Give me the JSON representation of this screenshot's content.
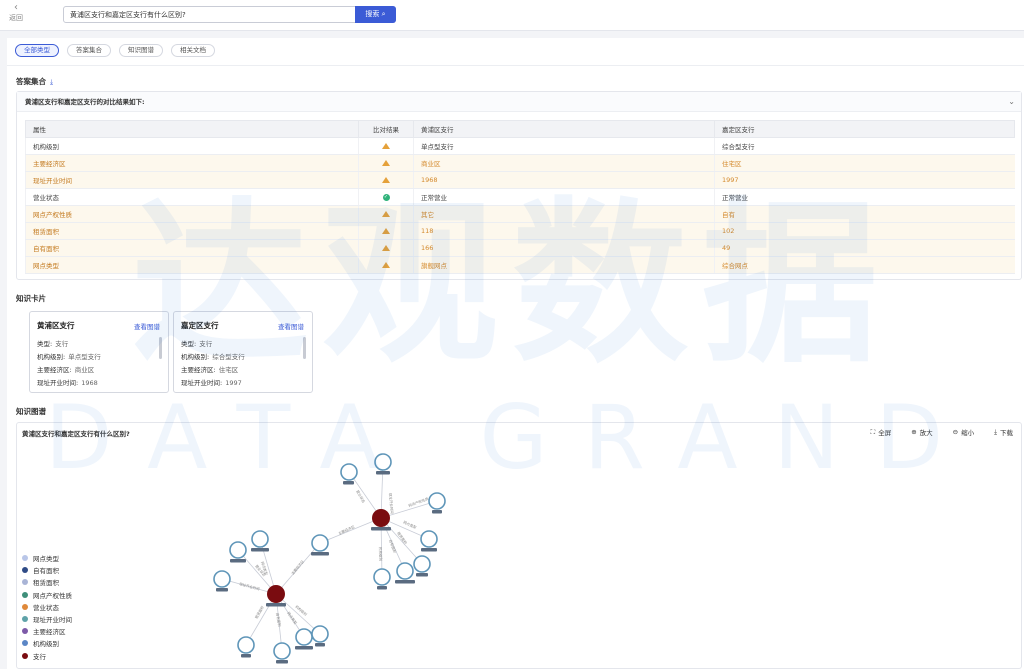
{
  "topbar": {
    "back_label": "返回",
    "search_value": "黄浦区支行和嘉定区支行有什么区别?",
    "search_button": "搜索"
  },
  "tabs": [
    {
      "label": "全部类型",
      "active": true
    },
    {
      "label": "答案集合",
      "active": false
    },
    {
      "label": "知识图谱",
      "active": false
    },
    {
      "label": "相关文档",
      "active": false
    }
  ],
  "answer": {
    "section_title": "答案集合",
    "summary": "黄浦区支行和嘉定区支行的对比结果如下:",
    "columns": [
      "属性",
      "比对结果",
      "黄浦区支行",
      "嘉定区支行"
    ],
    "rows": [
      {
        "attr": "机构级别",
        "result": "diff",
        "a": "单点型支行",
        "b": "综合型支行",
        "highlight": false
      },
      {
        "attr": "主要经济区",
        "result": "diff",
        "a": "商业区",
        "b": "住宅区",
        "highlight": true
      },
      {
        "attr": "现址开业时间",
        "result": "diff",
        "a": "1968",
        "b": "1997",
        "highlight": true
      },
      {
        "attr": "营业状态",
        "result": "same",
        "a": "正常营业",
        "b": "正常营业",
        "highlight": false
      },
      {
        "attr": "网点产权性质",
        "result": "diff",
        "a": "其它",
        "b": "自有",
        "highlight": true
      },
      {
        "attr": "租赁面积",
        "result": "diff",
        "a": "118",
        "b": "102",
        "highlight": true
      },
      {
        "attr": "自有面积",
        "result": "diff",
        "a": "166",
        "b": "49",
        "highlight": true
      },
      {
        "attr": "网点类型",
        "result": "diff",
        "a": "旗舰网点",
        "b": "综合网点",
        "highlight": true
      }
    ]
  },
  "cards": {
    "section_title": "知识卡片",
    "view_label": "查看图谱",
    "items": [
      {
        "title": "黄浦区支行",
        "fields": [
          {
            "k": "类型",
            "v": "支行"
          },
          {
            "k": "机构级别",
            "v": "单点型支行"
          },
          {
            "k": "主要经济区",
            "v": "商业区"
          },
          {
            "k": "现址开业时间",
            "v": "1968"
          }
        ]
      },
      {
        "title": "嘉定区支行",
        "fields": [
          {
            "k": "类型",
            "v": "支行"
          },
          {
            "k": "机构级别",
            "v": "综合型支行"
          },
          {
            "k": "主要经济区",
            "v": "住宅区"
          },
          {
            "k": "现址开业时间",
            "v": "1997"
          }
        ]
      }
    ]
  },
  "graph": {
    "section_title": "知识图谱",
    "query": "黄浦区支行和嘉定区支行有什么区别?",
    "tools": {
      "fullscreen": "全屏",
      "zoom_in": "放大",
      "zoom_out": "缩小",
      "download": "下载"
    },
    "legend": [
      {
        "label": "网点类型",
        "color": "#b9c6e8"
      },
      {
        "label": "自有面积",
        "color": "#2f4b86"
      },
      {
        "label": "租赁面积",
        "color": "#a9b4d6"
      },
      {
        "label": "网点产权性质",
        "color": "#3f8f7a"
      },
      {
        "label": "营业状态",
        "color": "#e0893a"
      },
      {
        "label": "现址开业时间",
        "color": "#5ea2a8"
      },
      {
        "label": "主要经济区",
        "color": "#7d5aa8"
      },
      {
        "label": "机构级别",
        "color": "#5b86c6"
      },
      {
        "label": "支行",
        "color": "#7a0c10"
      }
    ]
  },
  "watermark": {
    "line1": "达观数据",
    "line2": "DATA GRAND"
  }
}
